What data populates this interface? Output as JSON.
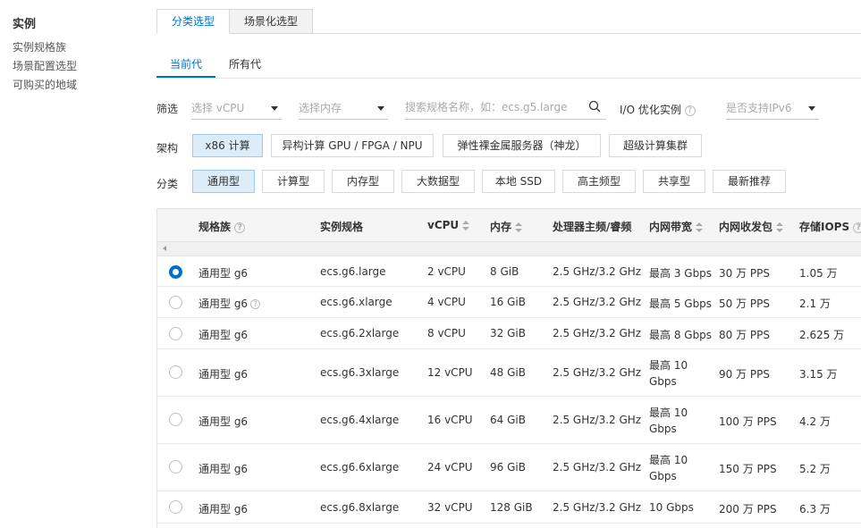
{
  "sidebar": {
    "title": "实例",
    "items": [
      {
        "label": "实例规格族"
      },
      {
        "label": "场景配置选型"
      },
      {
        "label": "可购买的地域"
      }
    ]
  },
  "main_tabs": [
    {
      "label": "分类选型",
      "active": true
    },
    {
      "label": "场景化选型",
      "active": false
    }
  ],
  "sub_tabs": [
    {
      "label": "当前代",
      "active": true
    },
    {
      "label": "所有代",
      "active": false
    }
  ],
  "filter": {
    "label": "筛选",
    "vcpu_placeholder": "选择 vCPU",
    "memory_placeholder": "选择内存",
    "search_placeholder": "搜索规格名称，如：ecs.g5.large",
    "io_label": "I/O 优化实例",
    "ipv6_placeholder": "是否支持IPv6"
  },
  "arch": {
    "label": "架构",
    "options": [
      {
        "label": "x86 计算",
        "active": true
      },
      {
        "label": "异构计算 GPU / FPGA / NPU",
        "active": false
      },
      {
        "label": "弹性裸金属服务器（神龙）",
        "active": false
      },
      {
        "label": "超级计算集群",
        "active": false
      }
    ]
  },
  "category": {
    "label": "分类",
    "options": [
      {
        "label": "通用型",
        "active": true
      },
      {
        "label": "计算型",
        "active": false
      },
      {
        "label": "内存型",
        "active": false
      },
      {
        "label": "大数据型",
        "active": false
      },
      {
        "label": "本地 SSD",
        "active": false
      },
      {
        "label": "高主频型",
        "active": false
      },
      {
        "label": "共享型",
        "active": false
      },
      {
        "label": "最新推荐",
        "active": false
      }
    ]
  },
  "table": {
    "headers": {
      "family": "规格族",
      "spec": "实例规格",
      "vcpu": "vCPU",
      "memory": "内存",
      "cpu_freq": "处理器主频/睿频",
      "bandwidth": "内网带宽",
      "pps": "内网收发包",
      "iops": "存储IOPS"
    },
    "rows": [
      {
        "selected": true,
        "family": "通用型 g6",
        "spec": "ecs.g6.large",
        "vcpu": "2 vCPU",
        "memory": "8 GiB",
        "cpu_freq": "2.5 GHz/3.2 GHz",
        "bandwidth": "最高 3 Gbps",
        "pps": "30 万 PPS",
        "iops": "1.05 万"
      },
      {
        "selected": false,
        "family": "通用型 g6",
        "spec": "ecs.g6.xlarge",
        "vcpu": "4 vCPU",
        "memory": "16 GiB",
        "cpu_freq": "2.5 GHz/3.2 GHz",
        "bandwidth": "最高 5 Gbps",
        "pps": "50 万 PPS",
        "iops": "2.1 万",
        "help": true
      },
      {
        "selected": false,
        "family": "通用型 g6",
        "spec": "ecs.g6.2xlarge",
        "vcpu": "8 vCPU",
        "memory": "32 GiB",
        "cpu_freq": "2.5 GHz/3.2 GHz",
        "bandwidth": "最高 8 Gbps",
        "pps": "80 万 PPS",
        "iops": "2.625 万"
      },
      {
        "selected": false,
        "family": "通用型 g6",
        "spec": "ecs.g6.3xlarge",
        "vcpu": "12 vCPU",
        "memory": "48 GiB",
        "cpu_freq": "2.5 GHz/3.2 GHz",
        "bandwidth": "最高 10 Gbps",
        "pps": "90 万 PPS",
        "iops": "3.15 万"
      },
      {
        "selected": false,
        "family": "通用型 g6",
        "spec": "ecs.g6.4xlarge",
        "vcpu": "16 vCPU",
        "memory": "64 GiB",
        "cpu_freq": "2.5 GHz/3.2 GHz",
        "bandwidth": "最高 10 Gbps",
        "pps": "100 万 PPS",
        "iops": "4.2 万"
      },
      {
        "selected": false,
        "family": "通用型 g6",
        "spec": "ecs.g6.6xlarge",
        "vcpu": "24 vCPU",
        "memory": "96 GiB",
        "cpu_freq": "2.5 GHz/3.2 GHz",
        "bandwidth": "最高 10 Gbps",
        "pps": "150 万 PPS",
        "iops": "5.2 万"
      },
      {
        "selected": false,
        "family": "通用型 g6",
        "spec": "ecs.g6.8xlarge",
        "vcpu": "32 vCPU",
        "memory": "128 GiB",
        "cpu_freq": "2.5 GHz/3.2 GHz",
        "bandwidth": "10 Gbps",
        "pps": "200 万 PPS",
        "iops": "6.3 万"
      }
    ]
  },
  "colors": {
    "accent": "#0070cc",
    "active_option_bg": "#dcedf9"
  }
}
